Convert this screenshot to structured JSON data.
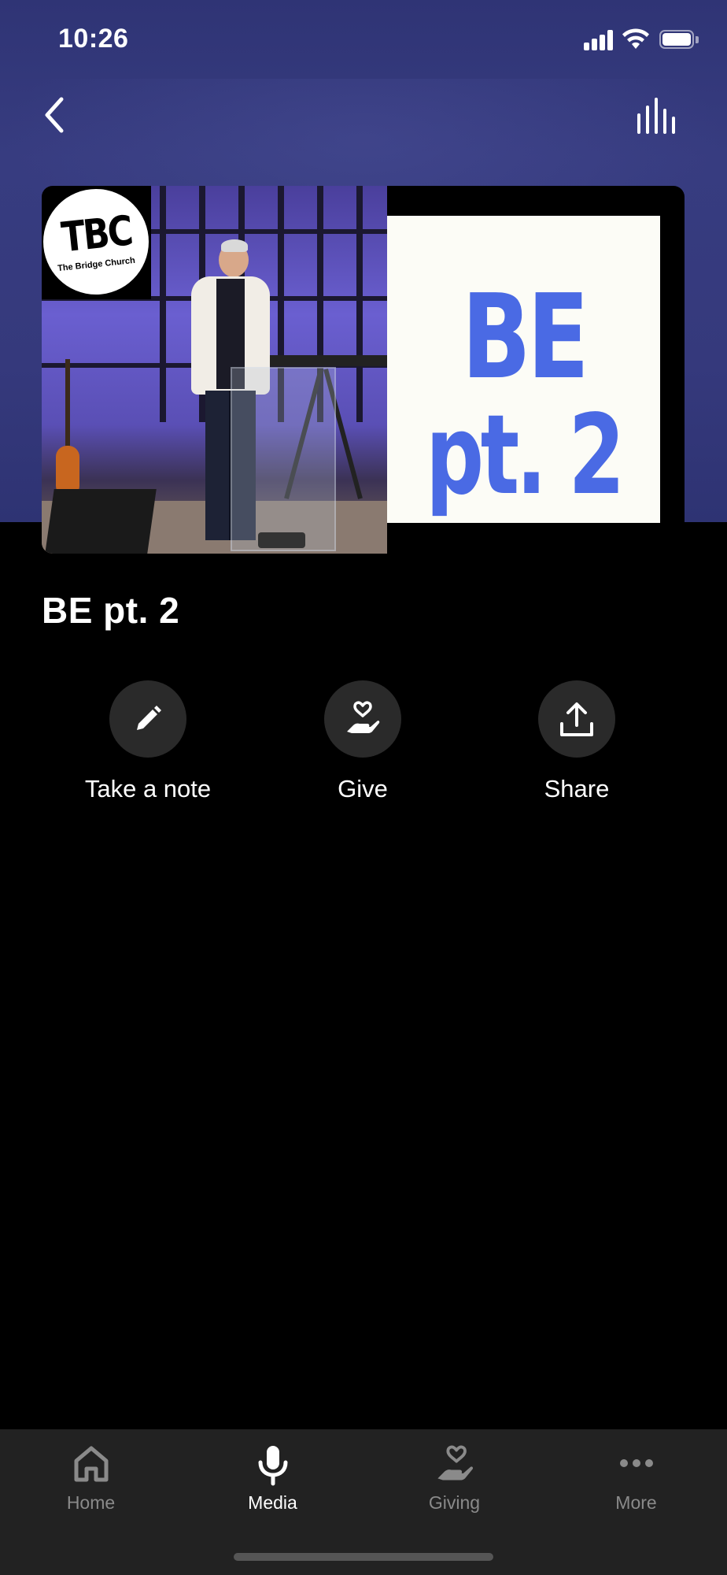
{
  "status_bar": {
    "time": "10:26"
  },
  "header": {
    "back_icon": "chevron-left-icon",
    "equalizer_icon": "audio-bars-icon"
  },
  "artwork": {
    "logo_text": "TBC",
    "logo_subtext": "The Bridge Church",
    "title_line1": "BE",
    "title_line2": "pt. 2"
  },
  "episode": {
    "title": "BE pt. 2"
  },
  "actions": [
    {
      "label": "Take a note",
      "icon": "pencil-icon"
    },
    {
      "label": "Give",
      "icon": "heart-hand-icon"
    },
    {
      "label": "Share",
      "icon": "share-upload-icon"
    }
  ],
  "tabs": [
    {
      "label": "Home",
      "icon": "home-icon",
      "active": false
    },
    {
      "label": "Media",
      "icon": "microphone-icon",
      "active": true
    },
    {
      "label": "Giving",
      "icon": "heart-hand-icon",
      "active": false
    },
    {
      "label": "More",
      "icon": "more-dots-icon",
      "active": false
    }
  ]
}
